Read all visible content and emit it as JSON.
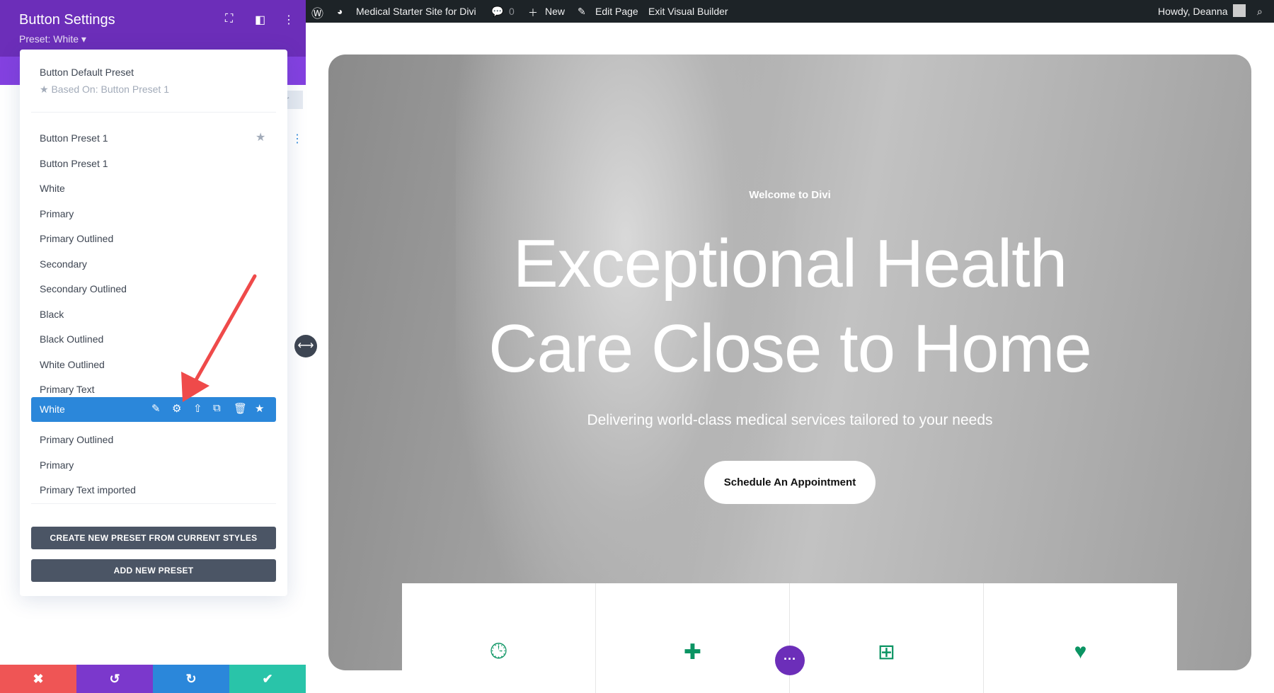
{
  "panel": {
    "title": "Button Settings",
    "preset_label": "Preset: White ▾",
    "ghost_text": "er"
  },
  "menu": {
    "default_title": "Button Default Preset",
    "based_on": "Based On: Button Preset 1",
    "items": [
      "Button Preset 1",
      "Button Preset 1",
      "White",
      "Primary",
      "Primary Outlined",
      "Secondary",
      "Secondary Outlined",
      "Black",
      "Black Outlined",
      "White Outlined",
      "Primary Text"
    ],
    "selected": "White",
    "after": [
      "Primary Outlined",
      "Primary",
      "Primary Text imported"
    ],
    "create_btn": "CREATE NEW PRESET FROM CURRENT STYLES",
    "add_btn": "ADD NEW PRESET"
  },
  "adminbar": {
    "site": "Medical Starter Site for Divi",
    "comments": "0",
    "new": "New",
    "edit": "Edit Page",
    "exit": "Exit Visual Builder",
    "howdy": "Howdy, Deanna"
  },
  "hero": {
    "welcome": "Welcome to Divi",
    "headline1": "Exceptional Health",
    "headline2": "Care Close to Home",
    "subtitle": "Delivering world-class medical services tailored to your needs",
    "cta": "Schedule An Appointment"
  },
  "colors": {
    "purple": "#6c2eb9",
    "blue": "#2b87da",
    "red": "#ef5555",
    "green": "#29c4a9",
    "icon_green": "#0b9463"
  }
}
